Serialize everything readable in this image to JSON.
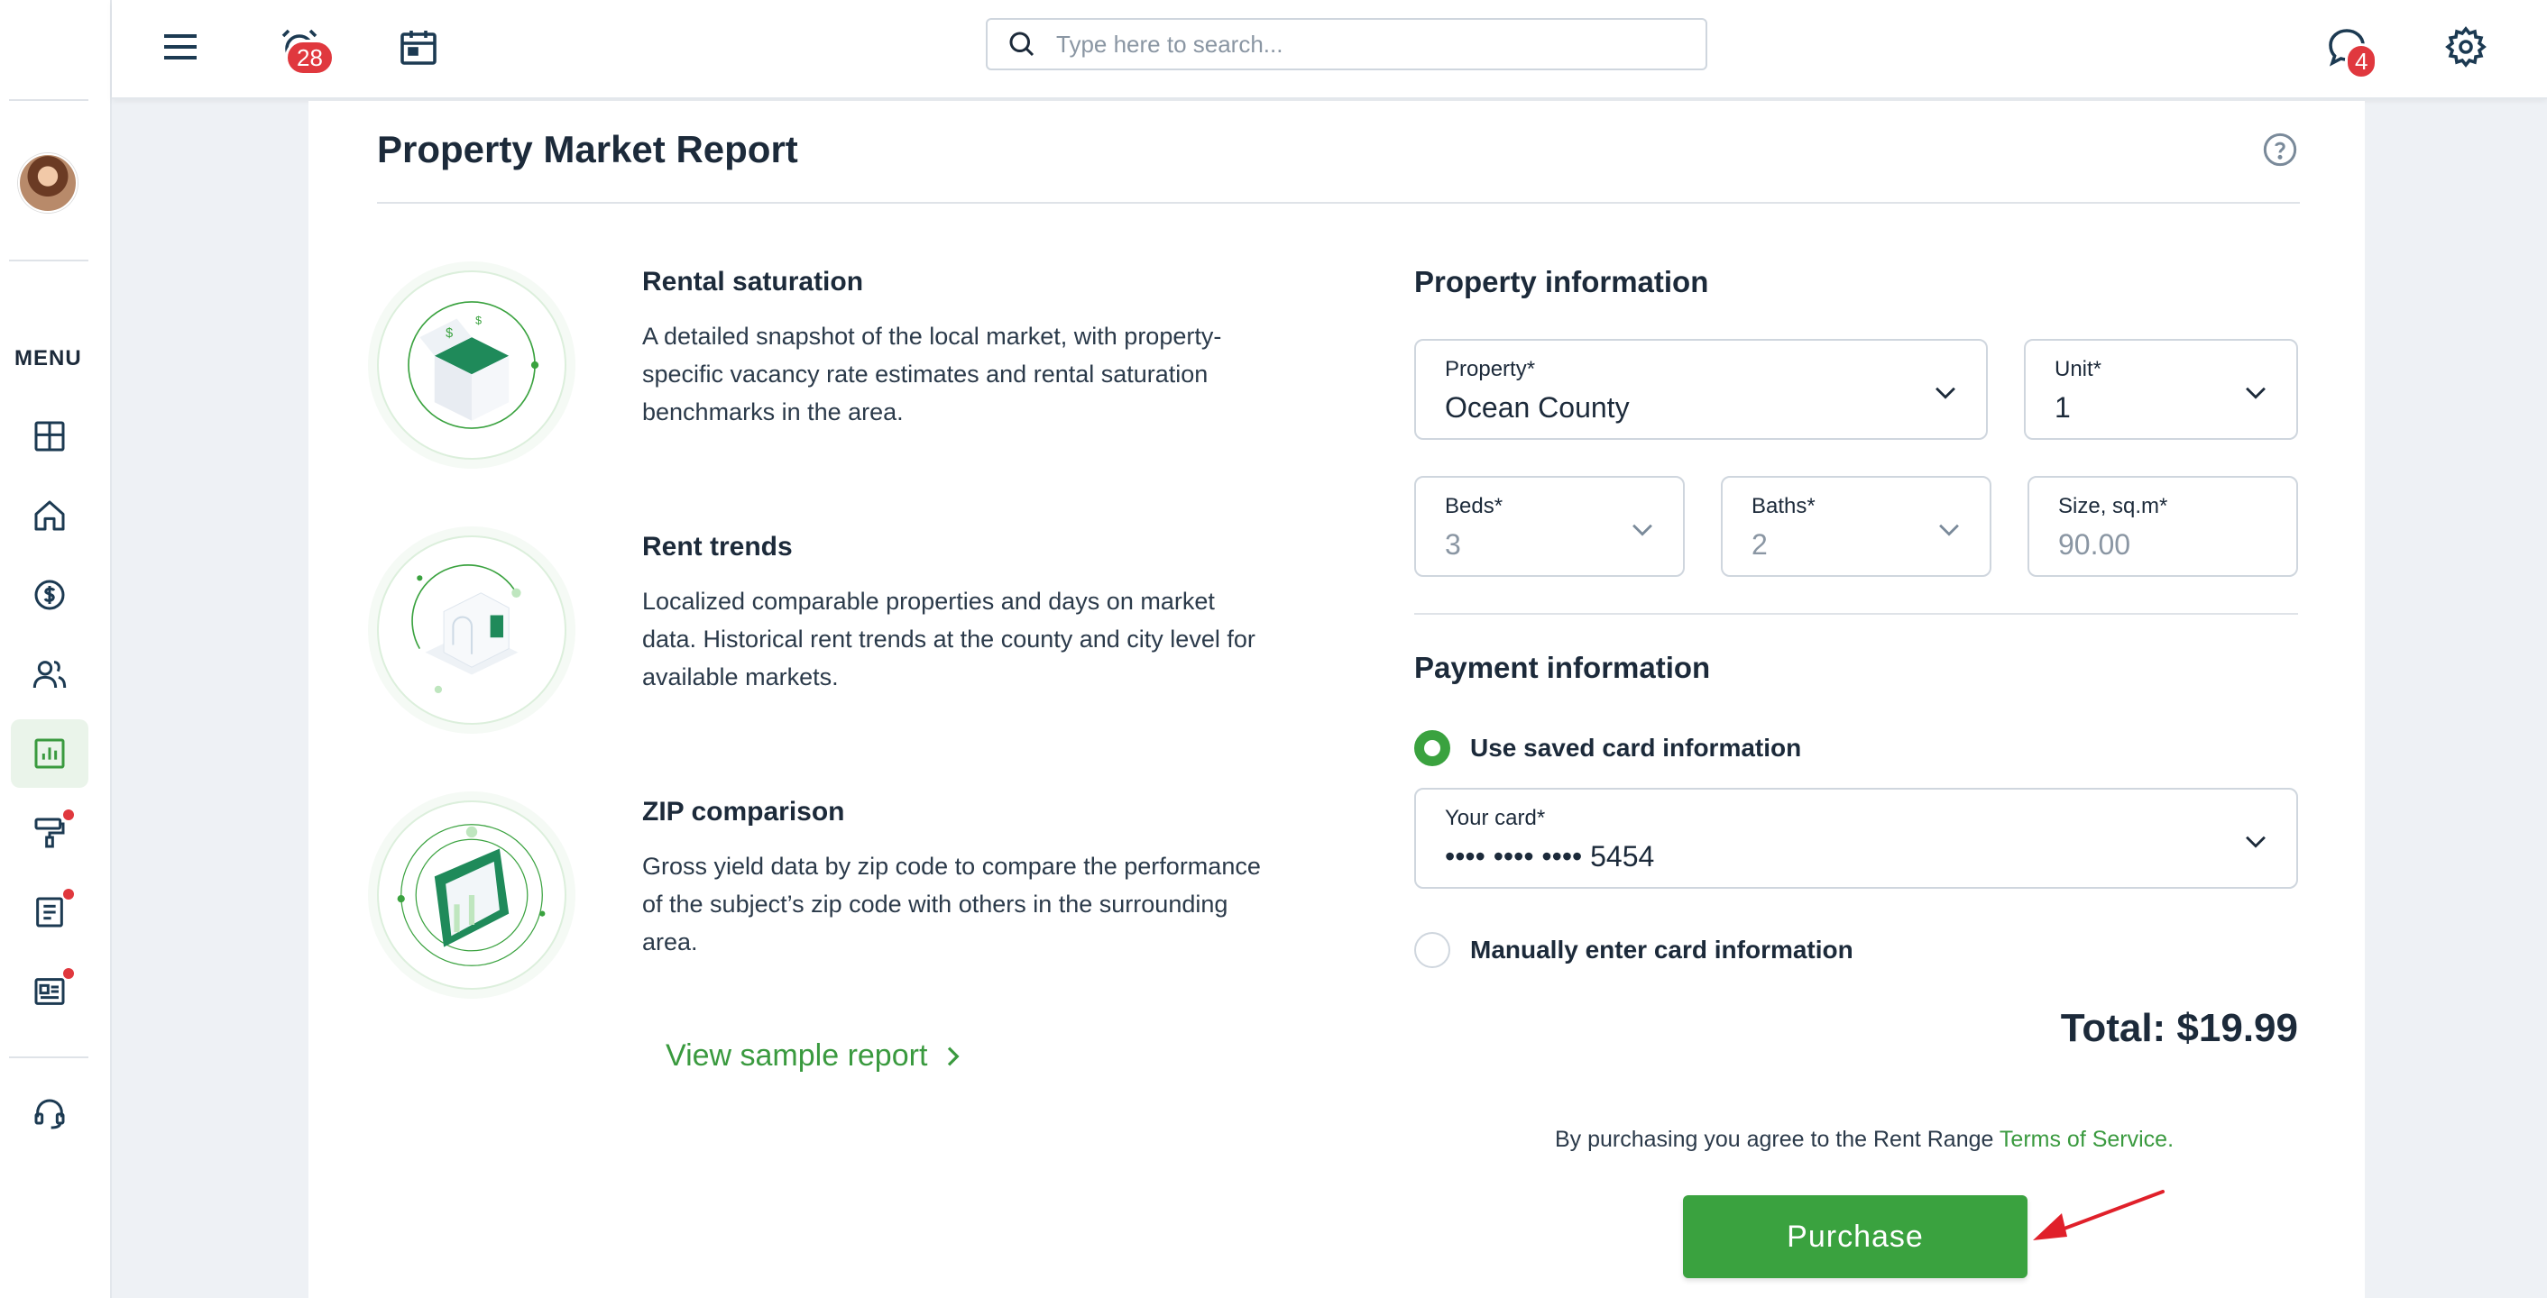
{
  "topbar": {
    "alerts_badge": "28",
    "messages_badge": "4",
    "search_placeholder": "Type here to search..."
  },
  "sidebar": {
    "menu_label": "MENU",
    "items": [
      {
        "icon": "dashboard-icon"
      },
      {
        "icon": "home-icon"
      },
      {
        "icon": "dollar-icon"
      },
      {
        "icon": "people-icon"
      },
      {
        "icon": "reports-icon",
        "active": true
      },
      {
        "icon": "paint-roller-icon",
        "dot": true
      },
      {
        "icon": "document-icon",
        "dot": true
      },
      {
        "icon": "news-icon",
        "dot": true
      },
      {
        "icon": "headset-icon"
      }
    ]
  },
  "page": {
    "title": "Property Market Report",
    "features": [
      {
        "title": "Rental saturation",
        "desc": "A detailed snapshot of the local market, with property-specific vacancy rate estimates and rental saturation benchmarks in the area."
      },
      {
        "title": "Rent trends",
        "desc": "Localized comparable properties and days on market data. Historical rent trends at the county and city level for available markets."
      },
      {
        "title": "ZIP comparison",
        "desc": "Gross yield data by zip code to compare the performance of the subject’s zip code with others in the surrounding area."
      }
    ],
    "sample_link": "View sample report"
  },
  "property": {
    "section_title": "Property information",
    "property_label": "Property*",
    "property_value": "Ocean County",
    "unit_label": "Unit*",
    "unit_value": "1",
    "beds_label": "Beds*",
    "beds_value": "3",
    "baths_label": "Baths*",
    "baths_value": "2",
    "size_label": "Size, sq.m*",
    "size_value": "90.00"
  },
  "payment": {
    "section_title": "Payment information",
    "saved_option": "Use saved card information",
    "card_label": "Your card*",
    "card_value": "•••• •••• •••• 5454",
    "manual_option": "Manually enter card information",
    "total": "Total: $19.99",
    "terms_text": "By purchasing you agree to the Rent Range ",
    "terms_link": "Terms of Service.",
    "purchase_label": "Purchase"
  },
  "colors": {
    "accent": "#3aa23f",
    "badge": "#e0383e",
    "annotation_arrow": "#e0202a"
  }
}
